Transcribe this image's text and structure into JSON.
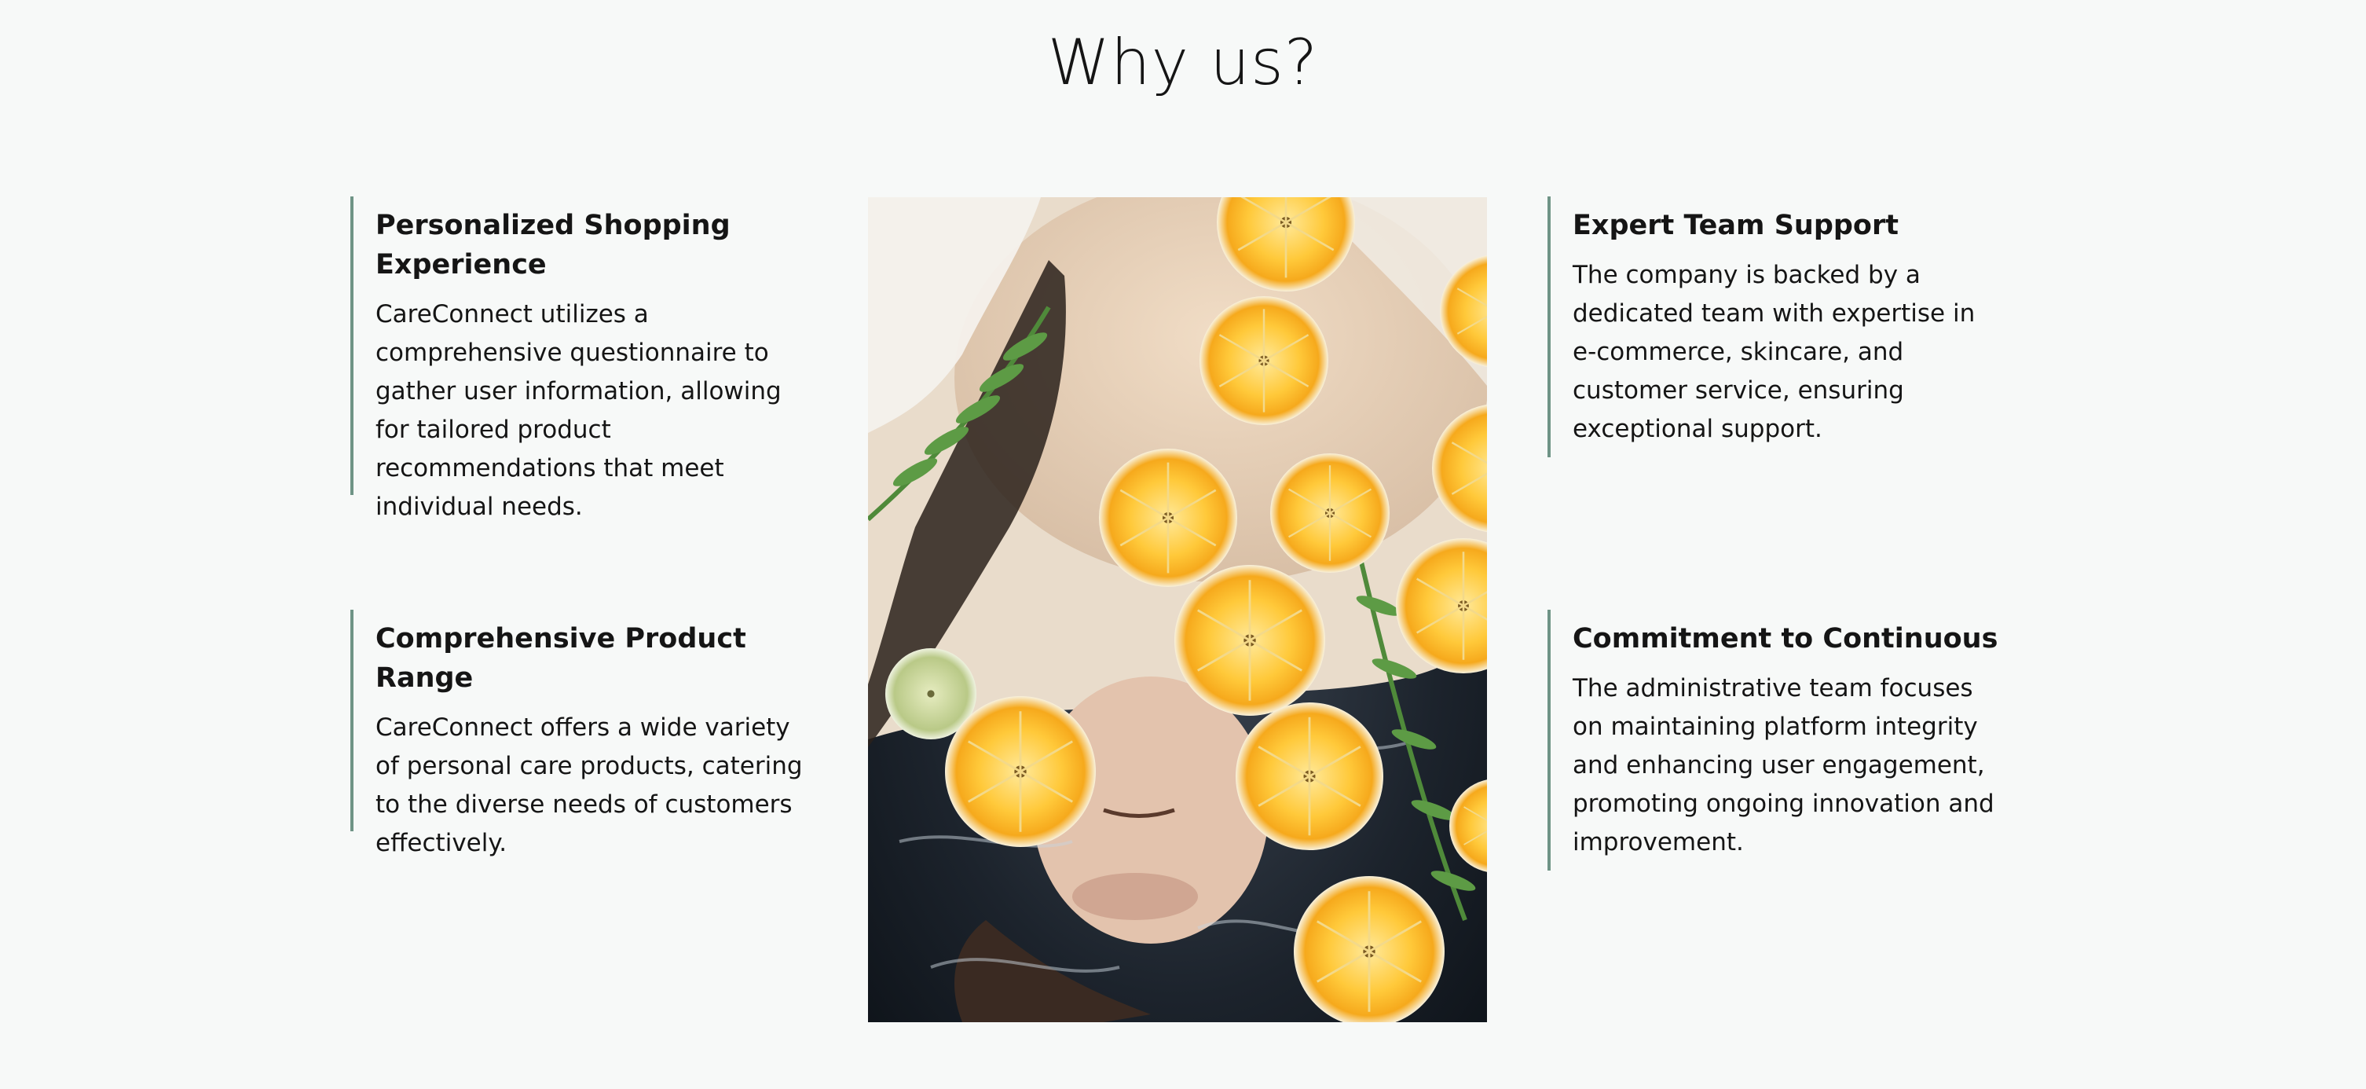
{
  "section": {
    "title": "Why us?"
  },
  "features": [
    {
      "title": "Personalized Shopping Experience",
      "body": "CareConnect utilizes a comprehensive questionnaire to gather user information, allowing for tailored product recommendations that meet individual needs."
    },
    {
      "title": "Comprehensive Product Range",
      "body": "CareConnect offers a wide variety of personal care products, catering to the diverse needs of customers effectively."
    },
    {
      "title": "Expert Team Support",
      "body": "The company is backed by a dedicated team with expertise in e-commerce, skincare, and customer service, ensuring exceptional support."
    },
    {
      "title": "Commitment to Continuous",
      "body": "The administrative team focuses on maintaining platform integrity and enhancing user engagement, promoting ongoing innovation and improvement."
    }
  ],
  "colors": {
    "background": "#f7f9f8",
    "accent_border": "#6f9486",
    "text": "#151515"
  }
}
